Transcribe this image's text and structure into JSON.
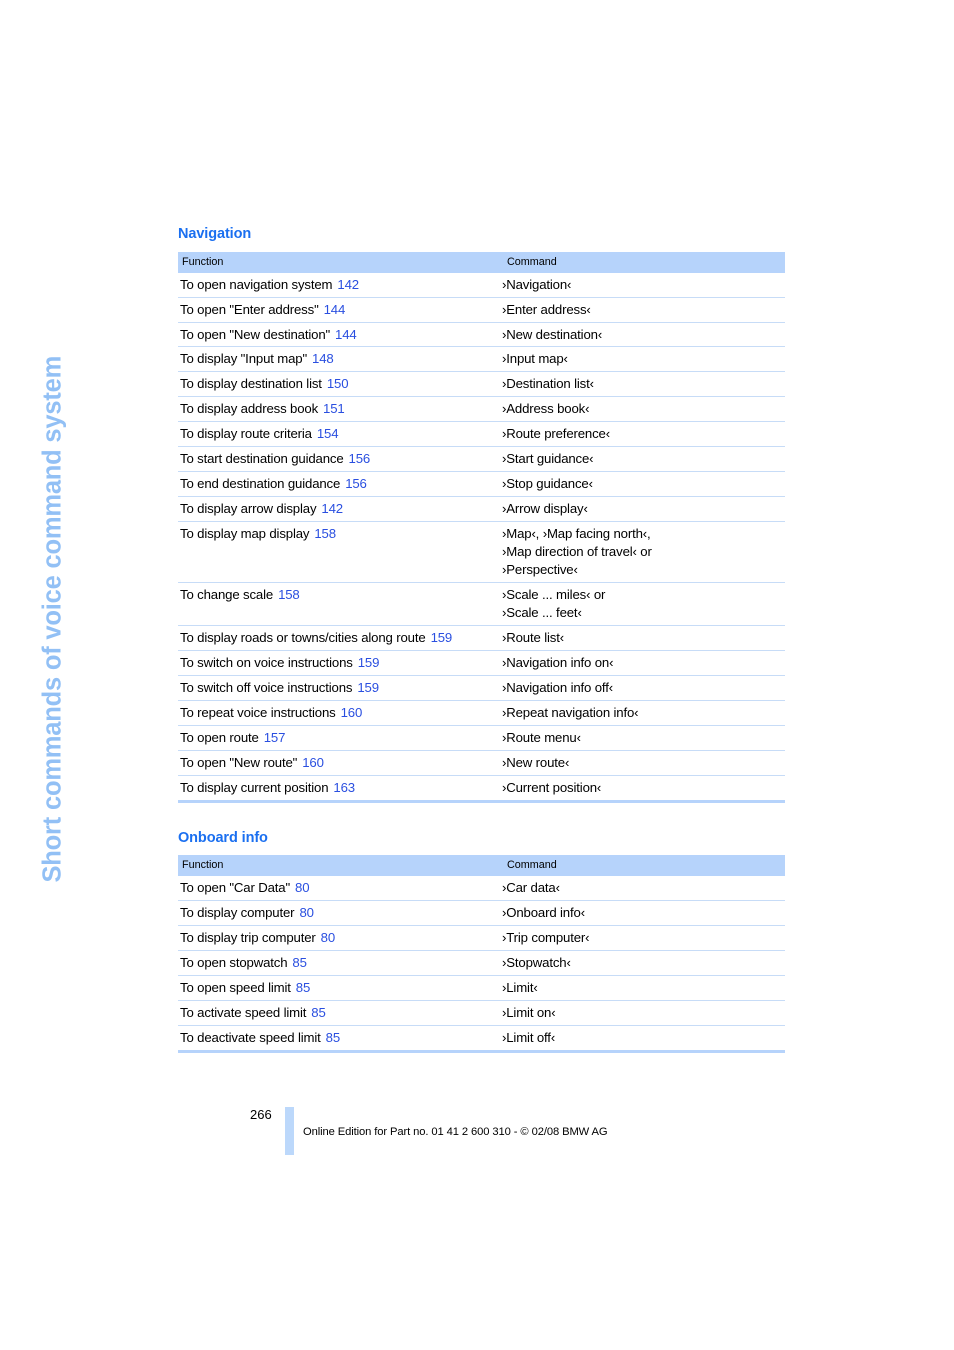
{
  "chapter_title": "Short commands of voice command system",
  "sections": [
    {
      "heading": "Navigation",
      "columns": {
        "function": "Function",
        "command": "Command"
      },
      "rows": [
        {
          "function": "To open navigation system",
          "page": "142",
          "command": "›Navigation‹"
        },
        {
          "function": "To open \"Enter address\"",
          "page": "144",
          "command": "›Enter address‹"
        },
        {
          "function": "To open \"New destination\"",
          "page": "144",
          "command": "›New destination‹"
        },
        {
          "function": "To display \"Input map\"",
          "page": "148",
          "command": "›Input map‹"
        },
        {
          "function": "To display destination list",
          "page": "150",
          "command": "›Destination list‹"
        },
        {
          "function": "To display address book",
          "page": "151",
          "command": "›Address book‹"
        },
        {
          "function": "To display route criteria",
          "page": "154",
          "command": "›Route preference‹"
        },
        {
          "function": "To start destination guidance",
          "page": "156",
          "command": "›Start guidance‹"
        },
        {
          "function": "To end destination guidance",
          "page": "156",
          "command": "›Stop guidance‹"
        },
        {
          "function": "To display arrow display",
          "page": "142",
          "command": "›Arrow display‹"
        },
        {
          "function": "To display map display",
          "page": "158",
          "command": "›Map‹, ›Map facing north‹,\n›Map direction of travel‹ or\n›Perspective‹"
        },
        {
          "function": "To change scale",
          "page": "158",
          "command": "›Scale ... miles‹ or\n›Scale ... feet‹"
        },
        {
          "function": "To display roads or towns/cities along route",
          "page": "159",
          "command": "›Route list‹"
        },
        {
          "function": "To switch on voice instructions",
          "page": "159",
          "command": "›Navigation info on‹"
        },
        {
          "function": "To switch off voice instructions",
          "page": "159",
          "command": "›Navigation info off‹"
        },
        {
          "function": "To repeat voice instructions",
          "page": "160",
          "command": "›Repeat navigation info‹"
        },
        {
          "function": "To open route",
          "page": "157",
          "command": "›Route menu‹"
        },
        {
          "function": "To open \"New route\"",
          "page": "160",
          "command": "›New route‹"
        },
        {
          "function": "To display current position",
          "page": "163",
          "command": "›Current position‹"
        }
      ]
    },
    {
      "heading": "Onboard info",
      "columns": {
        "function": "Function",
        "command": "Command"
      },
      "rows": [
        {
          "function": "To open \"Car Data\"",
          "page": "80",
          "command": "›Car data‹"
        },
        {
          "function": "To display computer",
          "page": "80",
          "command": "›Onboard info‹"
        },
        {
          "function": "To display trip computer",
          "page": "80",
          "command": "›Trip computer‹"
        },
        {
          "function": "To open stopwatch",
          "page": "85",
          "command": "›Stopwatch‹"
        },
        {
          "function": "To open speed limit",
          "page": "85",
          "command": "›Limit‹"
        },
        {
          "function": "To activate speed limit",
          "page": "85",
          "command": "›Limit on‹"
        },
        {
          "function": "To deactivate speed limit",
          "page": "85",
          "command": "›Limit off‹"
        }
      ]
    }
  ],
  "footer": {
    "page_number": "266",
    "edition_line": "Online Edition for Part no. 01 41 2 600 310 - © 02/08 BMW AG"
  },
  "colors": {
    "heading_blue": "#1a6ff0",
    "page_ref_blue": "#2a4fe0",
    "table_header_band": "#b6d3fb",
    "row_rule": "#c7dcf7",
    "side_title_blue": "#92c0f5"
  }
}
